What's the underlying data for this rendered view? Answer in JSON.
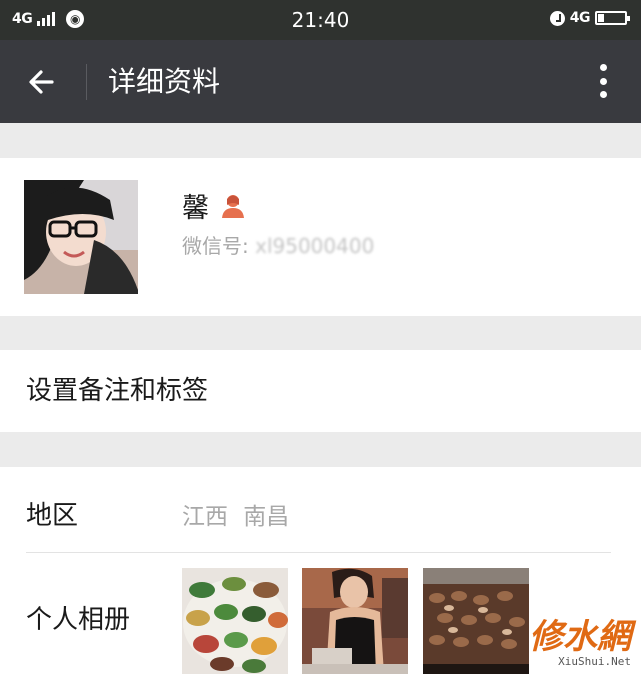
{
  "status_bar": {
    "network": "4G",
    "time": "21:40",
    "right_network": "4G",
    "icons": [
      "signal-icon",
      "app-notification-icon",
      "alarm-icon",
      "battery-icon"
    ]
  },
  "nav": {
    "title": "详细资料",
    "back_icon": "back-arrow-icon",
    "more_icon": "more-vertical-icon"
  },
  "profile": {
    "name": "馨",
    "gender_icon": "female-user-icon",
    "wechat_id_prefix": "微信号: ",
    "wechat_id_value": "xl95000400"
  },
  "remark": {
    "label": "设置备注和标签"
  },
  "details": {
    "region_label": "地区",
    "region_value": "江西  南昌",
    "album_label": "个人相册",
    "album_photos": [
      "dinner-table-photo",
      "woman-photo",
      "grilled-food-photo"
    ]
  },
  "watermark": {
    "main": "修水網",
    "sub": "XiuShui.Net"
  },
  "colors": {
    "status_bar_bg": "#2f322f",
    "title_bar_bg": "#393a3f",
    "page_bg": "#ebebeb",
    "secondary_text": "#a8a8a8",
    "gender_icon": "#e6704e",
    "watermark": "#e06a14"
  }
}
